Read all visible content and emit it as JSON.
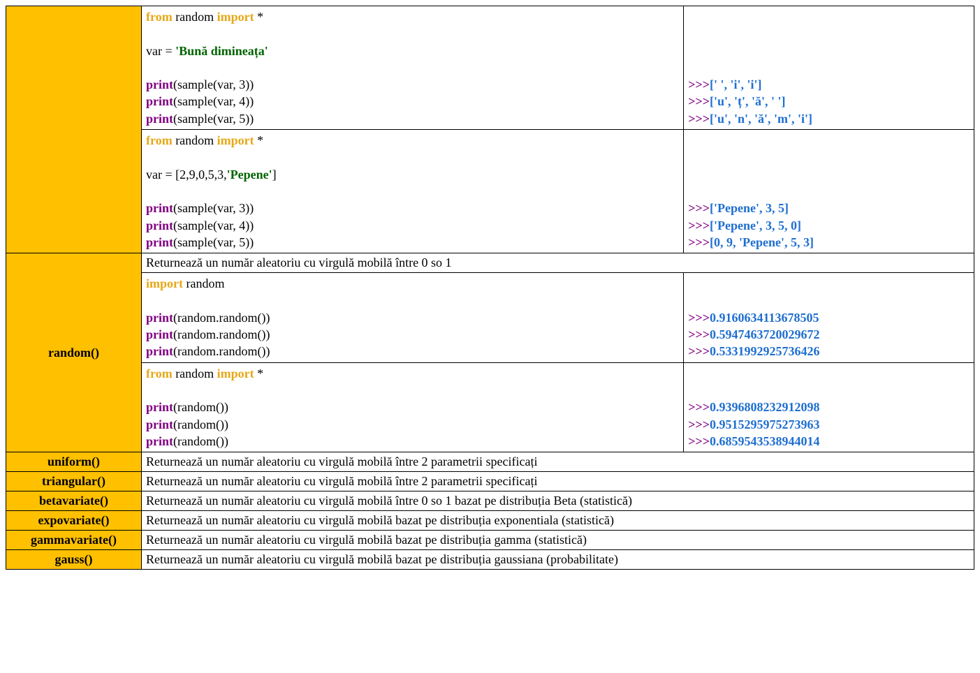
{
  "rows": {
    "r1": {
      "code": [
        [
          {
            "t": "from ",
            "c": "kw-from"
          },
          {
            "t": "random "
          },
          {
            "t": "import",
            "c": "kw-import"
          },
          {
            "t": " *"
          }
        ],
        [],
        [
          {
            "t": "var = "
          },
          {
            "t": "'Bună dimineața'",
            "c": "str"
          }
        ],
        [],
        [
          {
            "t": "print",
            "c": "kw-print"
          },
          {
            "t": "(sample(var, 3))"
          }
        ],
        [
          {
            "t": "print",
            "c": "kw-print"
          },
          {
            "t": "(sample(var, 4))"
          }
        ],
        [
          {
            "t": "print",
            "c": "kw-print"
          },
          {
            "t": "(sample(var, 5))"
          }
        ]
      ],
      "out": [
        "[' ', 'i', 'i']",
        "['u', 'ț', 'ă', ' ']",
        "['u', 'n', 'ă', 'm', 'i']"
      ]
    },
    "r2": {
      "code": [
        [
          {
            "t": "from ",
            "c": "kw-from"
          },
          {
            "t": "random "
          },
          {
            "t": "import",
            "c": "kw-import"
          },
          {
            "t": " *"
          }
        ],
        [],
        [
          {
            "t": "var = [2,9,0,5,3,"
          },
          {
            "t": "'Pepene'",
            "c": "str"
          },
          {
            "t": "]"
          }
        ],
        [],
        [
          {
            "t": "print",
            "c": "kw-print"
          },
          {
            "t": "(sample(var, 3))"
          }
        ],
        [
          {
            "t": "print",
            "c": "kw-print"
          },
          {
            "t": "(sample(var, 4))"
          }
        ],
        [
          {
            "t": "print",
            "c": "kw-print"
          },
          {
            "t": "(sample(var, 5))"
          }
        ]
      ],
      "out": [
        "['Pepene', 3, 5]",
        "['Pepene', 3, 5, 0]",
        "[0, 9, 'Pepene', 5, 3]"
      ]
    },
    "r3": {
      "fn": "random()",
      "desc": "Returnează un număr aleatoriu cu virgulă mobilă între 0 so 1",
      "code1": [
        [
          {
            "t": "import",
            "c": "kw-import"
          },
          {
            "t": " random"
          }
        ],
        [],
        [
          {
            "t": "print",
            "c": "kw-print"
          },
          {
            "t": "(random.random())"
          }
        ],
        [
          {
            "t": "print",
            "c": "kw-print"
          },
          {
            "t": "(random.random())"
          }
        ],
        [
          {
            "t": "print",
            "c": "kw-print"
          },
          {
            "t": "(random.random())"
          }
        ]
      ],
      "out1": [
        "0.9160634113678505",
        "0.5947463720029672",
        "0.5331992925736426"
      ],
      "code2": [
        [
          {
            "t": "from ",
            "c": "kw-from"
          },
          {
            "t": "random "
          },
          {
            "t": "import",
            "c": "kw-import"
          },
          {
            "t": " *"
          }
        ],
        [],
        [
          {
            "t": "print",
            "c": "kw-print"
          },
          {
            "t": "(random())"
          }
        ],
        [
          {
            "t": "print",
            "c": "kw-print"
          },
          {
            "t": "(random())"
          }
        ],
        [
          {
            "t": "print",
            "c": "kw-print"
          },
          {
            "t": "(random())"
          }
        ]
      ],
      "out2": [
        "0.9396808232912098",
        "0.9515295975273963",
        "0.6859543538944014"
      ]
    },
    "simple": [
      {
        "fn": "uniform()",
        "desc": "Returnează un număr aleatoriu cu virgulă mobilă între 2 parametrii specificați"
      },
      {
        "fn": "triangular()",
        "desc": "Returnează un număr aleatoriu cu virgulă mobilă între 2 parametrii specificați"
      },
      {
        "fn": "betavariate()",
        "desc": "Returnează un număr aleatoriu cu virgulă mobilă între 0 so 1 bazat pe distribuția Beta (statistică)"
      },
      {
        "fn": "expovariate()",
        "desc": "Returnează un număr aleatoriu cu virgulă mobilă bazat pe distribuția exponentiala (statistică)"
      },
      {
        "fn": "gammavariate()",
        "desc": "Returnează un număr aleatoriu cu virgulă mobilă bazat pe distribuția gamma (statistică)"
      },
      {
        "fn": "gauss()",
        "desc": "Returnează un număr aleatoriu cu virgulă mobilă bazat pe distribuția gaussiana (probabilitate)"
      }
    ]
  },
  "prompt": ">>>"
}
